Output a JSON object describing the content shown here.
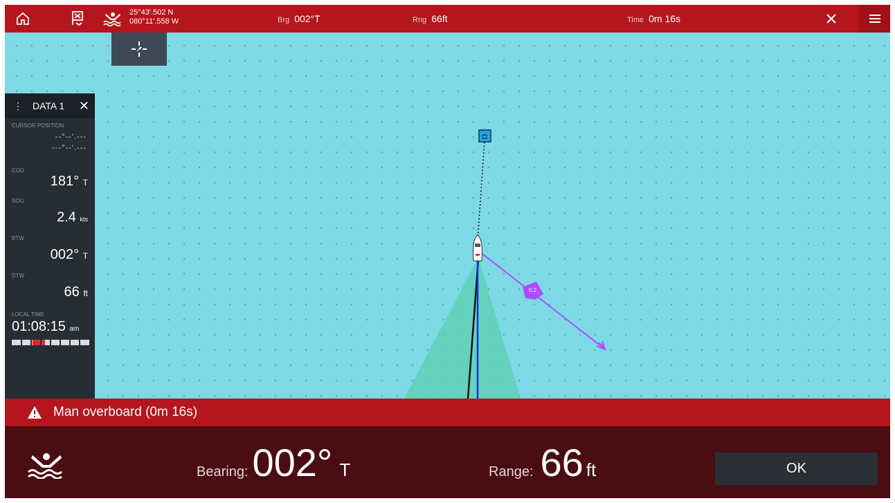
{
  "topbar": {
    "latitude": "25°43'.502 N",
    "longitude": "080°11'.558 W",
    "bearing_label": "Brg",
    "bearing_value": "002°T",
    "range_label": "Rng",
    "range_value": "66ft",
    "time_label": "Time",
    "time_value": "0m 16s"
  },
  "panel": {
    "title": "DATA 1",
    "cursor_label": "CURSOR POSITION",
    "cursor_lat": "--°--'.---",
    "cursor_lon": "---°--'.---",
    "cog_label": "COG",
    "cog_value": "181°",
    "cog_unit": "T",
    "sog_label": "SOG",
    "sog_value": "2.4",
    "sog_unit": "kts",
    "btw_label": "BTW",
    "btw_value": "002°",
    "btw_unit": "T",
    "dtw_label": "DTW",
    "dtw_value": "66",
    "dtw_unit": "ft",
    "time_label": "LOCAL TIME",
    "time_value": "01:08:15",
    "time_unit": "am"
  },
  "chart": {
    "tide_arrow_label": "0.2"
  },
  "alarm": {
    "message": "Man overboard (0m 16s)"
  },
  "bottom": {
    "bearing_label": "Bearing:",
    "bearing_value": "002°",
    "bearing_unit": "T",
    "range_label": "Range:",
    "range_value": "66",
    "range_unit": "ft",
    "ok_label": "OK"
  },
  "colors": {
    "accent_red": "#b5161d",
    "sea": "#7dd9e6",
    "panel": "#262d33",
    "tide_arrow": "#b04cff"
  }
}
